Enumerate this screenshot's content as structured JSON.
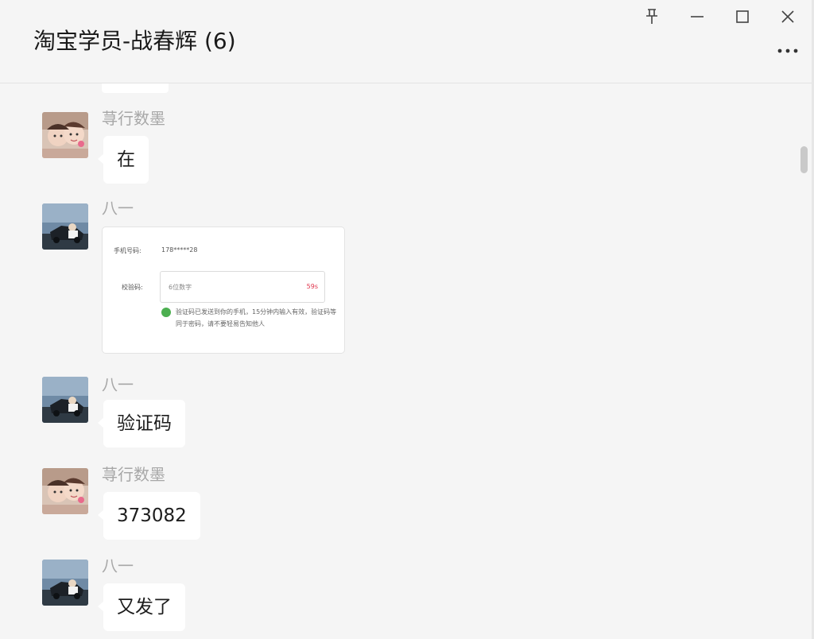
{
  "window": {
    "title": "淘宝学员-战春辉 (6)",
    "controls": [
      {
        "name": "pin",
        "icon": "pin-icon"
      },
      {
        "name": "minimize",
        "icon": "minimize-icon"
      },
      {
        "name": "maximize",
        "icon": "maximize-icon"
      },
      {
        "name": "close",
        "icon": "close-icon"
      }
    ],
    "more_icon": "more-dots-icon"
  },
  "messages": [
    {
      "sender": "荨行数墨",
      "type": "text",
      "text": "在",
      "avatar": "avatar-girls"
    },
    {
      "sender": "八一",
      "type": "image",
      "avatar": "avatar-car",
      "image": {
        "phone_label": "手机号码:",
        "phone_value": "178*****28",
        "code_label": "校验码:",
        "code_placeholder": "6位数字",
        "countdown": "59s",
        "note": "验证码已发送到你的手机，15分钟内输入有效，验证码等同于密码，请不要轻易告知他人"
      }
    },
    {
      "sender": "八一",
      "type": "text",
      "text": "验证码",
      "avatar": "avatar-car"
    },
    {
      "sender": "荨行数墨",
      "type": "text",
      "text": "373082",
      "avatar": "avatar-girls"
    },
    {
      "sender": "八一",
      "type": "text",
      "text": "又发了",
      "avatar": "avatar-car"
    }
  ],
  "colors": {
    "background": "#f5f5f5",
    "bubble": "#ffffff",
    "sender_name": "#a7a7a7",
    "countdown": "#e0334b"
  }
}
